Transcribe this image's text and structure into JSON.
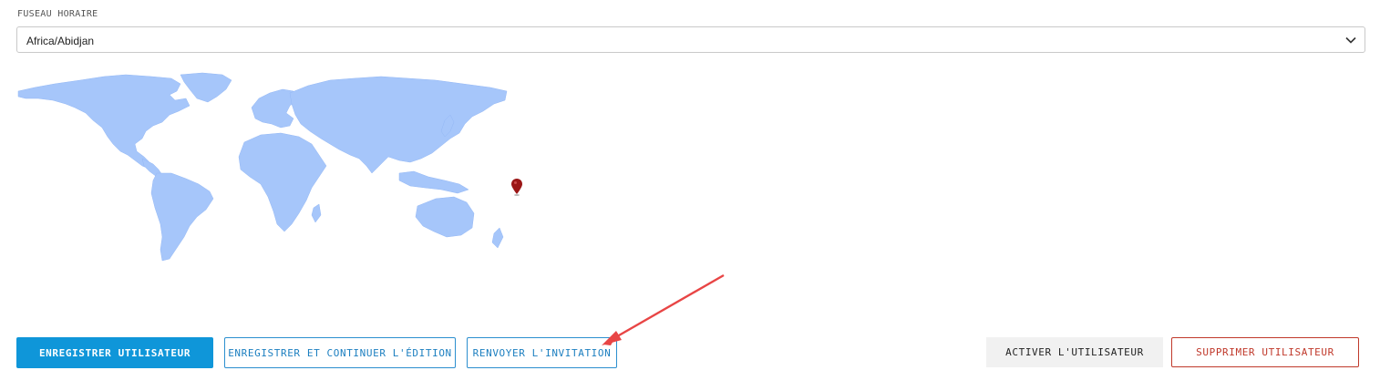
{
  "timezone": {
    "label": "FUSEAU HORAIRE",
    "selected": "Africa/Abidjan"
  },
  "map": {
    "land_color": "#a6c6fa",
    "marker_color": "#9b1616"
  },
  "actions": {
    "save_user": "ENREGISTRER UTILISATEUR",
    "save_and_continue": "ENREGISTRER ET CONTINUER L'ÉDITION",
    "resend_invitation": "RENVOYER L'INVITATION",
    "activate_user": "ACTIVER L'UTILISATEUR",
    "delete_user": "SUPPRIMER UTILISATEUR"
  },
  "annotation": {
    "arrow_color": "#e84545"
  },
  "colors": {
    "primary": "#0f96d9",
    "danger": "#c0392b"
  }
}
